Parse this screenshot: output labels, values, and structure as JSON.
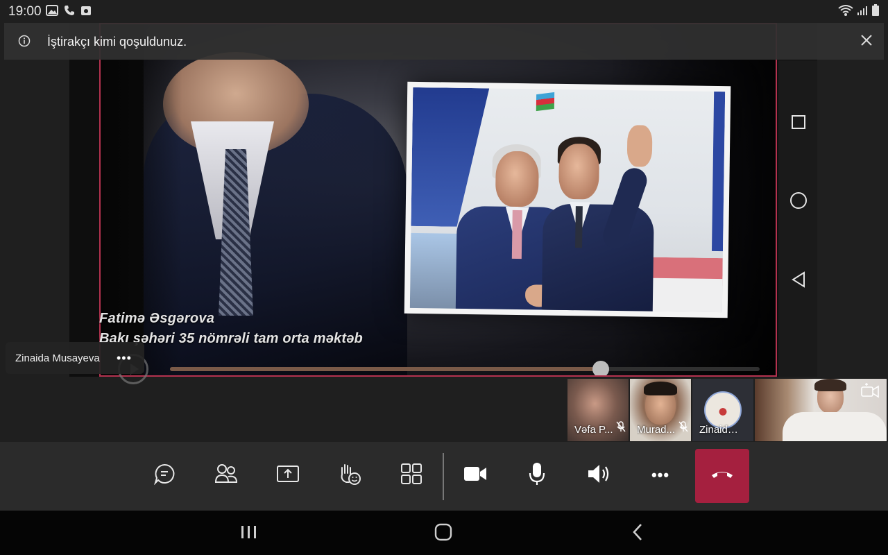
{
  "status_bar": {
    "time": "19:00"
  },
  "banner": {
    "text": "İştirakçı kimi qoşuldunuz."
  },
  "stage": {
    "caption_line1": "Fatimə Əsgərova",
    "caption_line2": "Bakı şəhəri 35 nömrəli tam orta məktəb",
    "progress": 0.73
  },
  "presenter": {
    "name": "Zinaida Musayeva",
    "more": "•••"
  },
  "participants": [
    {
      "name": "Vəfa P...",
      "muted": true
    },
    {
      "name": "Murad...",
      "muted": true
    },
    {
      "name": "Zinaida ...",
      "muted": false
    },
    {
      "name": "",
      "muted": false
    }
  ],
  "toolbar": {
    "buttons": [
      "chat-icon",
      "people-icon",
      "share-icon",
      "raise-hand-icon",
      "layout-icon",
      "camera-icon",
      "mic-icon",
      "speaker-icon",
      "more-icon",
      "hangup-icon"
    ],
    "more_label": "•••",
    "hangup_color": "#a5203f"
  },
  "colors": {
    "accent_border": "#b4324f",
    "toolbar_bg": "#2b2b2b"
  }
}
